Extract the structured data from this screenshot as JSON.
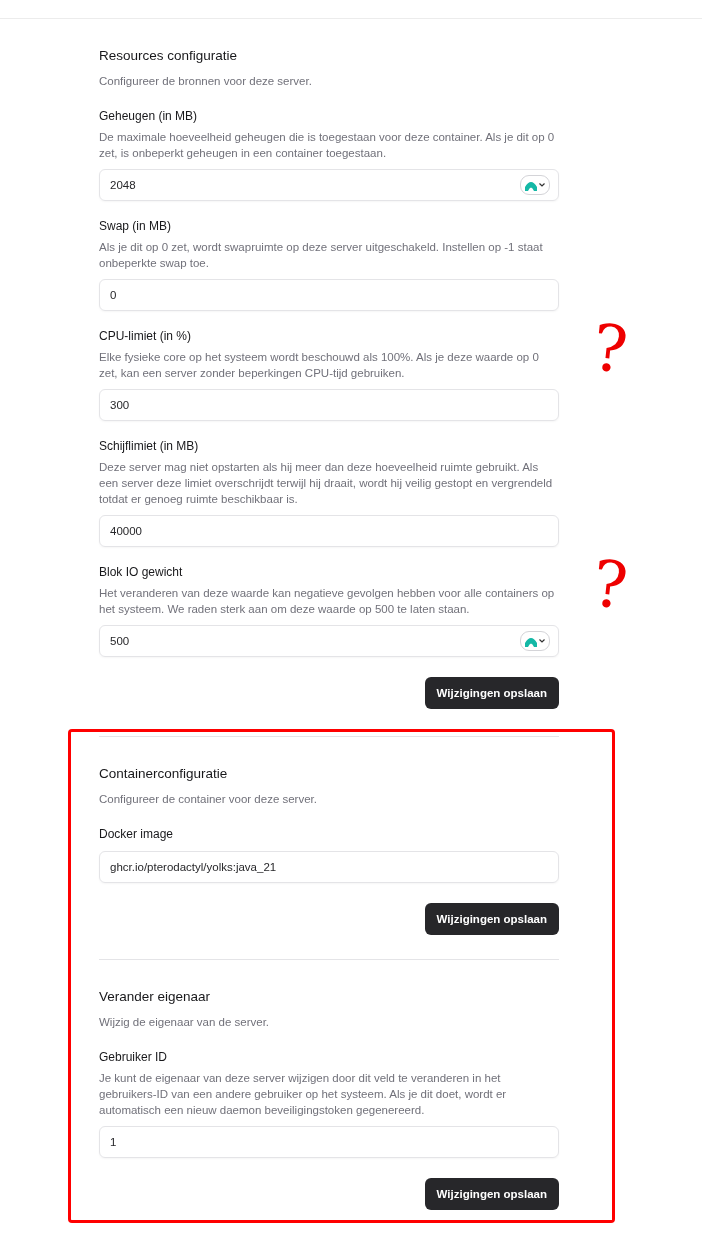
{
  "sections": [
    {
      "title": "Resources configuratie",
      "description": "Configureer de bronnen voor deze server.",
      "highlighted": false,
      "button": "Wijzigingen opslaan",
      "fields": [
        {
          "label": "Geheugen (in MB)",
          "help": "De maximale hoeveelheid geheugen die is toegestaan voor deze container. Als je dit op 0 zet, is onbeperkt geheugen in een container toegestaan.",
          "value": "2048",
          "badge": true
        },
        {
          "label": "Swap (in MB)",
          "help": "Als je dit op 0 zet, wordt swapruimte op deze server uitgeschakeld. Instellen op -1 staat onbeperkte swap toe.",
          "value": "0",
          "badge": false
        },
        {
          "label": "CPU-limiet (in %)",
          "help": "Elke fysieke core op het systeem wordt beschouwd als 100%. Als je deze waarde op 0 zet, kan een server zonder beperkingen CPU-tijd gebruiken.",
          "value": "300",
          "badge": false,
          "annotation": "?"
        },
        {
          "label": "Schijflimiet (in MB)",
          "help": "Deze server mag niet opstarten als hij meer dan deze hoeveelheid ruimte gebruikt. Als een server deze limiet overschrijdt terwijl hij draait, wordt hij veilig gestopt en vergrendeld totdat er genoeg ruimte beschikbaar is.",
          "value": "40000",
          "badge": false
        },
        {
          "label": "Blok IO gewicht",
          "help": "Het veranderen van deze waarde kan negatieve gevolgen hebben voor alle containers op het systeem. We raden sterk aan om deze waarde op 500 te laten staan.",
          "value": "500",
          "badge": true,
          "annotation": "?"
        }
      ]
    },
    {
      "title": "Containerconfiguratie",
      "description": "Configureer de container voor deze server.",
      "highlighted": true,
      "button": "Wijzigingen opslaan",
      "fields": [
        {
          "label": "Docker image",
          "value": "ghcr.io/pterodactyl/yolks:java_21",
          "badge": false
        }
      ]
    },
    {
      "title": "Verander eigenaar",
      "description": "Wijzig de eigenaar van de server.",
      "highlighted": true,
      "button": "Wijzigingen opslaan",
      "fields": [
        {
          "label": "Gebruiker ID",
          "help": "Je kunt de eigenaar van deze server wijzigen door dit veld te veranderen in het gebruikers-ID van een andere gebruiker op het systeem. Als je dit doet, wordt er automatisch een nieuw daemon beveiligingstoken gegenereerd.",
          "value": "1",
          "badge": false
        }
      ]
    }
  ]
}
